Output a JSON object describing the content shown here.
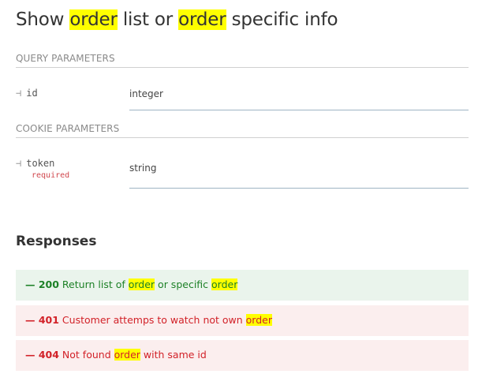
{
  "header": {
    "title_parts": [
      "Show ",
      "order",
      " list or ",
      "order",
      " specific info"
    ]
  },
  "query_parameters": {
    "label": "QUERY PARAMETERS",
    "params": [
      {
        "arrow": "⊣",
        "name": "id",
        "type": "integer"
      }
    ]
  },
  "cookie_parameters": {
    "label": "COOKIE PARAMETERS",
    "params": [
      {
        "arrow": "⊣",
        "name": "token",
        "required": "required",
        "type": "string"
      }
    ]
  },
  "responses": {
    "title": "Responses",
    "items": [
      {
        "dash": "—",
        "code": "200",
        "parts": [
          " Return list of ",
          "order",
          " or specific ",
          "order"
        ],
        "status": "success",
        "color": "#1d8127"
      },
      {
        "dash": "—",
        "code": "401",
        "parts": [
          " Customer attemps to watch not own ",
          "order"
        ],
        "status": "error",
        "color": "#d22128"
      },
      {
        "dash": "—",
        "code": "404",
        "parts": [
          " Not found ",
          "order",
          " with same id"
        ],
        "status": "error",
        "color": "#d22128"
      }
    ]
  },
  "colors": {
    "highlight": "#ffff00",
    "success_bg": "#eaf4ec",
    "error_bg": "#fbeeee"
  }
}
